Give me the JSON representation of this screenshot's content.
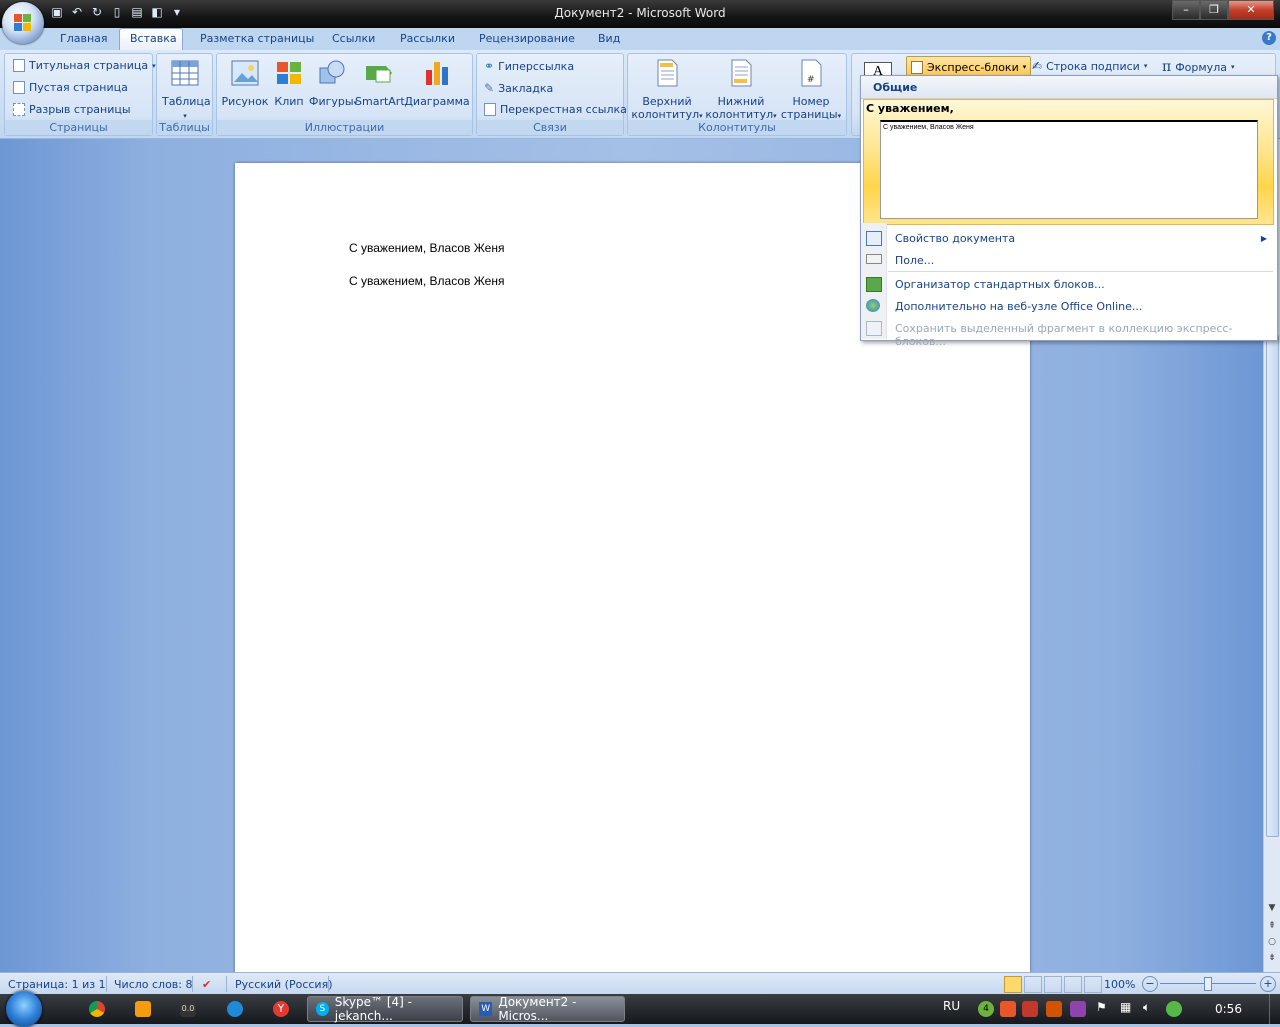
{
  "window": {
    "title": "Документ2 - Microsoft Word"
  },
  "tabs": [
    "Главная",
    "Вставка",
    "Разметка страницы",
    "Ссылки",
    "Рассылки",
    "Рецензирование",
    "Вид"
  ],
  "active_tab": "Вставка",
  "ribbon": {
    "pages": {
      "label": "Страницы",
      "items": [
        "Титульная страница",
        "Пустая страница",
        "Разрыв страницы"
      ]
    },
    "tables": {
      "label": "Таблицы",
      "table": "Таблица"
    },
    "illustrations": {
      "label": "Иллюстрации",
      "picture": "Рисунок",
      "clip": "Клип",
      "shapes": "Фигуры",
      "smartart": "SmartArt",
      "chart": "Диаграмма"
    },
    "links": {
      "label": "Связи",
      "hyperlink": "Гиперссылка",
      "bookmark": "Закладка",
      "crossref": "Перекрестная ссылка"
    },
    "headerfooter": {
      "label": "Колонтитулы",
      "header_l1": "Верхний",
      "header_l2": "колонтитул",
      "footer_l1": "Нижний",
      "footer_l2": "колонтитул",
      "pagenum_l1": "Номер",
      "pagenum_l2": "страницы"
    },
    "text": {
      "quickparts": "Экспресс-блоки",
      "signature": "Строка подписи",
      "formula": "Формула"
    }
  },
  "document": {
    "lines": [
      "С уважением, Власов Женя",
      "С уважением, Власов Женя"
    ]
  },
  "dropdown": {
    "header": "Общие",
    "item_title": "С уважением,",
    "item_preview": "С уважением, Власов Женя",
    "menu": [
      {
        "label": "Свойство документа",
        "submenu": true,
        "enabled": true
      },
      {
        "label": "Поле...",
        "enabled": true
      },
      {
        "label": "Организатор стандартных блоков...",
        "enabled": true
      },
      {
        "label": "Дополнительно на веб-узле Office Online...",
        "enabled": true
      },
      {
        "label": "Сохранить выделенный фрагмент в коллекцию экспресс-блоков...",
        "enabled": false
      }
    ]
  },
  "statusbar": {
    "page": "Страница: 1 из 1",
    "words": "Число слов: 8",
    "language": "Русский (Россия)",
    "zoom": "100%"
  },
  "taskbar": {
    "tasks": [
      {
        "label": "Skype™ [4] - jekanch..."
      },
      {
        "label": "Документ2 - Micros..."
      }
    ],
    "lang": "RU",
    "clock": "0:56",
    "tray_badge": "4"
  }
}
